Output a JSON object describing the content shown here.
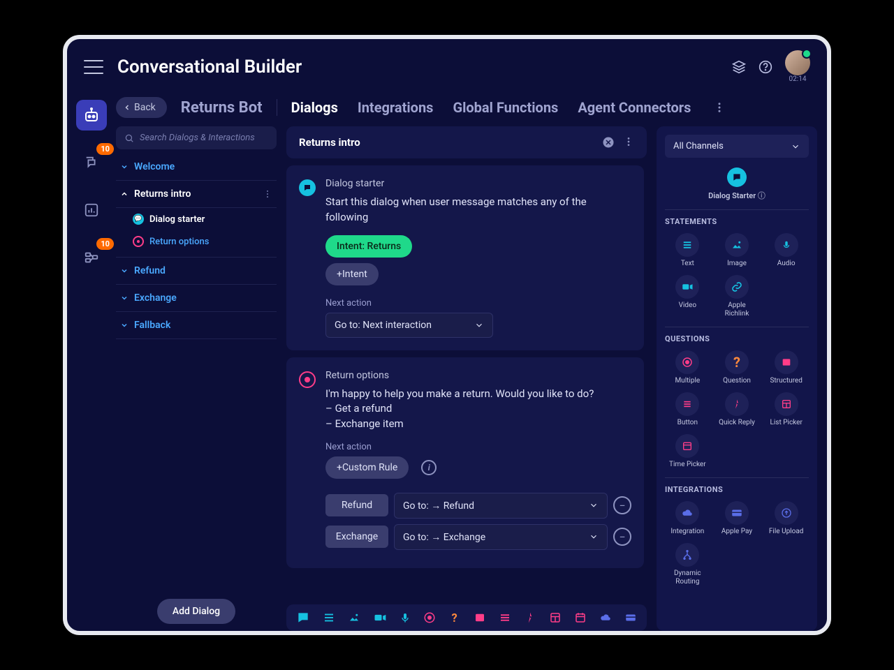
{
  "app_title": "Conversational Builder",
  "timer": "02:14",
  "leftnav": {
    "badge_chat": "10",
    "badge_flow": "10"
  },
  "header": {
    "back": "Back",
    "bot_name": "Returns Bot",
    "tabs": [
      "Dialogs",
      "Integrations",
      "Global Functions",
      "Agent Connectors"
    ]
  },
  "search_placeholder": "Search Dialogs & Interactions",
  "tree": {
    "welcome": "Welcome",
    "returns_intro": "Returns intro",
    "dialog_starter": "Dialog starter",
    "return_options": "Return options",
    "refund": "Refund",
    "exchange": "Exchange",
    "fallback": "Fallback"
  },
  "add_dialog": "Add Dialog",
  "center": {
    "title": "Returns intro",
    "card1": {
      "title": "Dialog starter",
      "desc": "Start this dialog when user message matches any of the following",
      "intent_chip": "Intent: Returns",
      "add_intent": "+Intent",
      "next_action_label": "Next action",
      "next_action_value": "Go to: Next interaction"
    },
    "card2": {
      "title": "Return options",
      "desc": "I'm happy to help you make a return. Would you like to do?\n– Get a refund\n– Exchange item",
      "next_action_label": "Next action",
      "custom_rule": "+Custom Rule",
      "rule1_label": "Refund",
      "rule1_value": "Go to: → Refund",
      "rule2_label": "Exchange",
      "rule2_value": "Go to: → Exchange"
    }
  },
  "right": {
    "channel": "All Channels",
    "dialog_starter": "Dialog Starter",
    "sections": {
      "statements": "STATEMENTS",
      "questions": "QUESTIONS",
      "integrations": "INTEGRATIONS"
    },
    "tools": {
      "text": "Text",
      "image": "Image",
      "audio": "Audio",
      "video": "Video",
      "apple_richlink": "Apple Richlink",
      "multiple": "Multiple",
      "question": "Question",
      "structured": "Structured",
      "button": "Button",
      "quick_reply": "Quick Reply",
      "list_picker": "List Picker",
      "time_picker": "Time Picker",
      "integration": "Integration",
      "apple_pay": "Apple Pay",
      "file_upload": "File Upload",
      "dynamic_routing": "Dynamic Routing"
    }
  }
}
